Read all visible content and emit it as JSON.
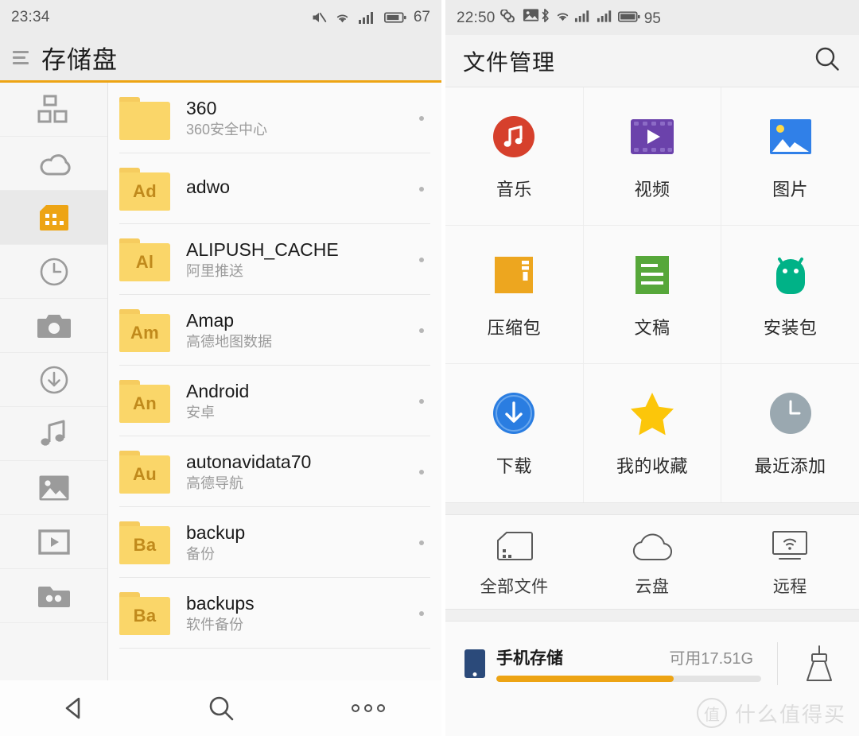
{
  "left": {
    "status": {
      "time": "23:34",
      "battery": "67",
      "icons": [
        "mute-icon",
        "wifi-icon",
        "signal-icon",
        "battery-icon"
      ]
    },
    "header": {
      "title": "存储盘",
      "menu_icon": "hamburger-icon",
      "accent_color": "#eda414"
    },
    "rail": [
      {
        "icon": "category-blocks-icon",
        "active": false
      },
      {
        "icon": "cloud-icon",
        "active": false
      },
      {
        "icon": "sdcard-icon",
        "active": true
      },
      {
        "icon": "clock-icon",
        "active": false
      },
      {
        "icon": "camera-icon",
        "active": false
      },
      {
        "icon": "download-circle-icon",
        "active": false
      },
      {
        "icon": "music-note-icon",
        "active": false
      },
      {
        "icon": "picture-icon",
        "active": false
      },
      {
        "icon": "video-play-icon",
        "active": false
      },
      {
        "icon": "folder-glasses-icon",
        "active": false
      }
    ],
    "files": [
      {
        "badge": "",
        "name": "360",
        "sub": "360安全中心"
      },
      {
        "badge": "Ad",
        "name": "adwo",
        "sub": ""
      },
      {
        "badge": "Al",
        "name": "ALIPUSH_CACHE",
        "sub": "阿里推送"
      },
      {
        "badge": "Am",
        "name": "Amap",
        "sub": "高德地图数据"
      },
      {
        "badge": "An",
        "name": "Android",
        "sub": "安卓"
      },
      {
        "badge": "Au",
        "name": "autonavidata70",
        "sub": "高德导航"
      },
      {
        "badge": "Ba",
        "name": "backup",
        "sub": "备份"
      },
      {
        "badge": "Ba",
        "name": "backups",
        "sub": "软件备份"
      }
    ],
    "navbar": [
      {
        "icon": "back-triangle-icon",
        "label": "back"
      },
      {
        "icon": "search-icon",
        "label": "search"
      },
      {
        "icon": "more-dots-icon",
        "label": "more"
      }
    ]
  },
  "right": {
    "status": {
      "time": "22:50",
      "battery": "95",
      "icons": [
        "infinity-icon",
        "screenshot-icon",
        "bluetooth-icon",
        "wifi-icon",
        "signal1-icon",
        "signal2-icon",
        "battery-icon"
      ]
    },
    "header": {
      "title": "文件管理",
      "search_icon": "search-icon"
    },
    "categories": [
      [
        {
          "label": "音乐",
          "icon": "music-icon",
          "color": "#d6402c"
        },
        {
          "label": "视频",
          "icon": "video-icon",
          "color": "#6b42ab"
        },
        {
          "label": "图片",
          "icon": "image-icon",
          "color": "#3080e8"
        }
      ],
      [
        {
          "label": "压缩包",
          "icon": "archive-icon",
          "color": "#eda61f"
        },
        {
          "label": "文稿",
          "icon": "document-icon",
          "color": "#56a73a"
        },
        {
          "label": "安装包",
          "icon": "android-icon",
          "color": "#00b287"
        }
      ],
      [
        {
          "label": "下载",
          "icon": "download-icon",
          "color": "#2a7de1"
        },
        {
          "label": "我的收藏",
          "icon": "star-icon",
          "color": "#fcc60a"
        },
        {
          "label": "最近添加",
          "icon": "recent-icon",
          "color": "#9aa8b0"
        }
      ]
    ],
    "sources": [
      {
        "label": "全部文件",
        "icon": "sdcard-outline-icon"
      },
      {
        "label": "云盘",
        "icon": "cloud-outline-icon"
      },
      {
        "label": "远程",
        "icon": "remote-screen-icon"
      }
    ],
    "storage": {
      "name": "手机存储",
      "free": "可用17.51G",
      "fill_percent": 67,
      "fill_color": "#eda414",
      "clean_icon": "broom-icon"
    },
    "watermark": {
      "mark": "值",
      "text": "什么值得买"
    }
  }
}
